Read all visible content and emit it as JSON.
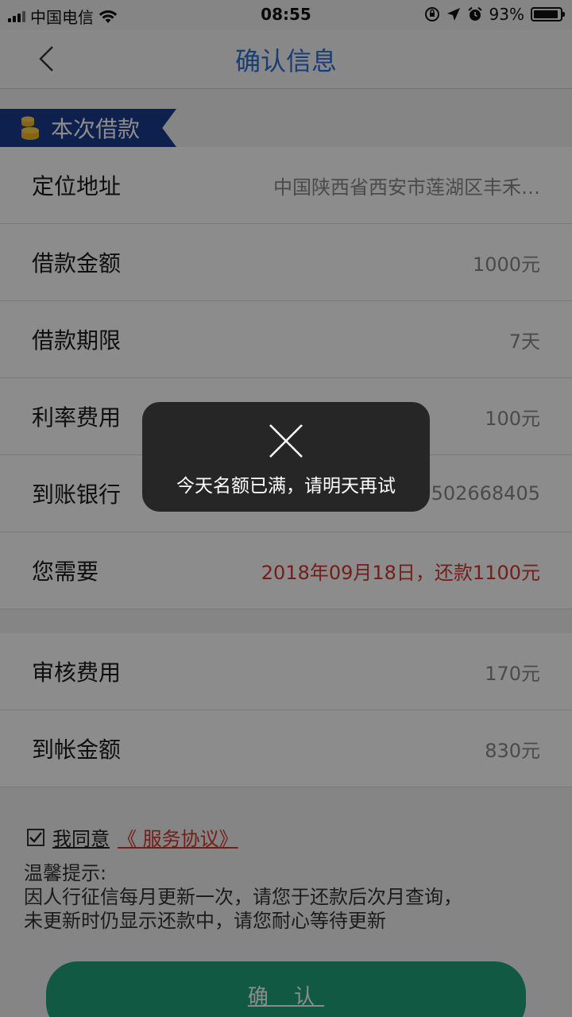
{
  "status_bar": {
    "carrier": "中国电信",
    "time": "08:55",
    "battery": "93%",
    "battery_level": 0.93
  },
  "header": {
    "title": "确认信息",
    "back_icon": "chevron-left-icon"
  },
  "section": {
    "label": "本次借款",
    "icon": "coin-stack-icon"
  },
  "rows_main": [
    {
      "label": "定位地址",
      "value": "中国陕西省西安市莲湖区丰禾…"
    },
    {
      "label": "借款金额",
      "value": "1000元"
    },
    {
      "label": "借款期限",
      "value": "7天"
    },
    {
      "label": "利率费用",
      "value": "100元"
    },
    {
      "label": "到账银行",
      "value": "2502668405"
    },
    {
      "label": "您需要",
      "value": "2018年09月18日，还款1100元"
    }
  ],
  "rows_fee": [
    {
      "label": "审核费用",
      "value": "170元"
    },
    {
      "label": "到帐金额",
      "value": "830元"
    }
  ],
  "agreement": {
    "checked": true,
    "text": "我同意",
    "link": "《 服务协议》"
  },
  "tips": {
    "title": "温馨提示:",
    "line1": "因人行征信每月更新一次，请您于还款后次月查询，",
    "line2": "未更新时仍显示还款中，请您耐心等待更新"
  },
  "confirm_label": "确 认",
  "toast": {
    "icon": "close-icon",
    "message": "今天名额已满，请明天再试"
  },
  "colors": {
    "accent_blue": "#2f6fd6",
    "tag_navy": "#1a3b8c",
    "warning_red": "#d23a2e",
    "button_green": "#1fa37a"
  }
}
